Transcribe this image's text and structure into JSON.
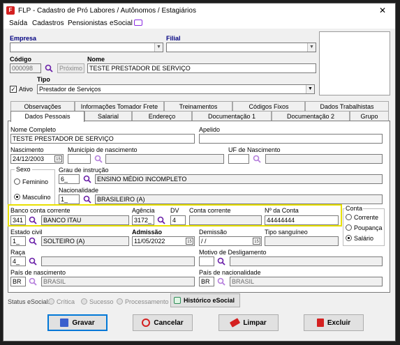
{
  "window": {
    "title": "FLP - Cadastro de Pró Labores / Autônomos / Estagiários",
    "close_glyph": "✕"
  },
  "menu": [
    "Saída",
    "Cadastros",
    "Pensionistas",
    "eSocial"
  ],
  "header": {
    "empresa_label": "Empresa",
    "filial_label": "Filial",
    "codigo_label": "Código",
    "codigo_value": "000098",
    "proximo_label": "Próximo",
    "nome_label": "Nome",
    "nome_value": "TESTE PRESTADOR DE SERVIÇO",
    "ativo_label": "Ativo",
    "ativo_checked": "✓",
    "tipo_label": "Tipo",
    "tipo_value": "Prestador de Serviços"
  },
  "tabs_row1": [
    "Observações",
    "Informações Tomador Frete",
    "Treinamentos",
    "Códigos Fixos",
    "Dados Trabalhistas"
  ],
  "tabs_row2": [
    "Dados Pessoais",
    "Salarial",
    "Endereço",
    "Documentação 1",
    "Documentação 2",
    "Grupo"
  ],
  "form": {
    "nome_completo_label": "Nome Completo",
    "nome_completo_value": "TESTE PRESTADOR DE SERVIÇO",
    "apelido_label": "Apelido",
    "nascimento_label": "Nascimento",
    "nascimento_value": "24/12/2003",
    "municipio_label": "Município de nascimento",
    "uf_label": "UF de Nascimento",
    "sexo_label": "Sexo",
    "sexo_feminino": "Feminino",
    "sexo_masculino": "Masculino",
    "grau_label": "Grau de instrução",
    "grau_code": "6_",
    "grau_value": "ENSINO MÉDIO INCOMPLETO",
    "nacionalidade_label": "Nacionalidade",
    "nacionalidade_code": "1_",
    "nacionalidade_value": "BRASILEIRO (A)",
    "banco_label": "Banco conta corrente",
    "banco_code": "341",
    "banco_name": "BANCO ITAU",
    "agencia_label": "Agência",
    "agencia_value": "3172_",
    "dv_label": "DV",
    "dv_value": "4",
    "conta_corrente_label": "Conta corrente",
    "nr_conta_label": "Nº da Conta",
    "nr_conta_value": "44444444",
    "conta_group_label": "Conta",
    "conta_corrente_opt": "Corrente",
    "conta_poupanca_opt": "Poupança",
    "conta_salario_opt": "Salário",
    "estado_civil_label": "Estado civil",
    "estado_civil_code": "1_",
    "estado_civil_value": "SOLTEIRO (A)",
    "admissao_label": "Admissão",
    "admissao_value": "11/05/2022",
    "demissao_label": "Demissão",
    "demissao_value": " / /",
    "tipo_sanguineo_label": "Tipo sanguíneo",
    "raca_label": "Raça",
    "raca_code": "4_",
    "motivo_label": "Motivo de Desligamento",
    "pais_nasc_label": "País de nascimento",
    "pais_nasc_code": "BR",
    "pais_nasc_value": "BRASIL",
    "pais_nac_label": "País de nacionalidade",
    "pais_nac_code": "BR",
    "pais_nac_value": "BRASIL",
    "cal_glyph": "15"
  },
  "status": {
    "label": "Status eSocial:",
    "critica": "Crítica",
    "sucesso": "Sucesso",
    "processamento": "Processamento",
    "historico": "Histórico eSocial"
  },
  "buttons": {
    "gravar": "Gravar",
    "cancelar": "Cancelar",
    "limpar": "Limpar",
    "excluir": "Excluir"
  },
  "colors": {
    "accent": "#000080",
    "highlight": "#e8e000",
    "magnifier": "#6a1fa8"
  }
}
